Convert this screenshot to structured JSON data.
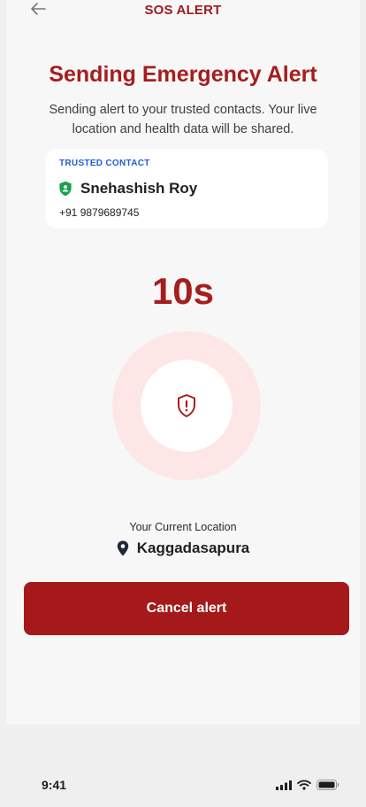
{
  "header": {
    "title": "SOS ALERT",
    "back_icon": "arrow-left-icon"
  },
  "main": {
    "title": "Sending Emergency Alert",
    "subtitle": "Sending alert to your trusted contacts. Your live location and health data will be shared.",
    "contact": {
      "label": "TRUSTED CONTACT",
      "name": "Snehashish Roy",
      "phone": "+91 9879689745",
      "icon": "shield-icon",
      "icon_color": "#16a34a"
    },
    "countdown": "10s",
    "center_icon": "shield-alert-icon",
    "location": {
      "label": "Your Current Location",
      "value": "Kaggadasapura",
      "icon": "location-pin-icon"
    },
    "cancel_label": "Cancel alert"
  },
  "status_bar": {
    "time": "9:41",
    "icons": [
      "signal-icon",
      "wifi-icon",
      "battery-icon"
    ]
  },
  "colors": {
    "accent": "#a61d1d",
    "button": "#a5191b",
    "ring": "#fde6e6",
    "label_blue": "#1f5fd6"
  }
}
